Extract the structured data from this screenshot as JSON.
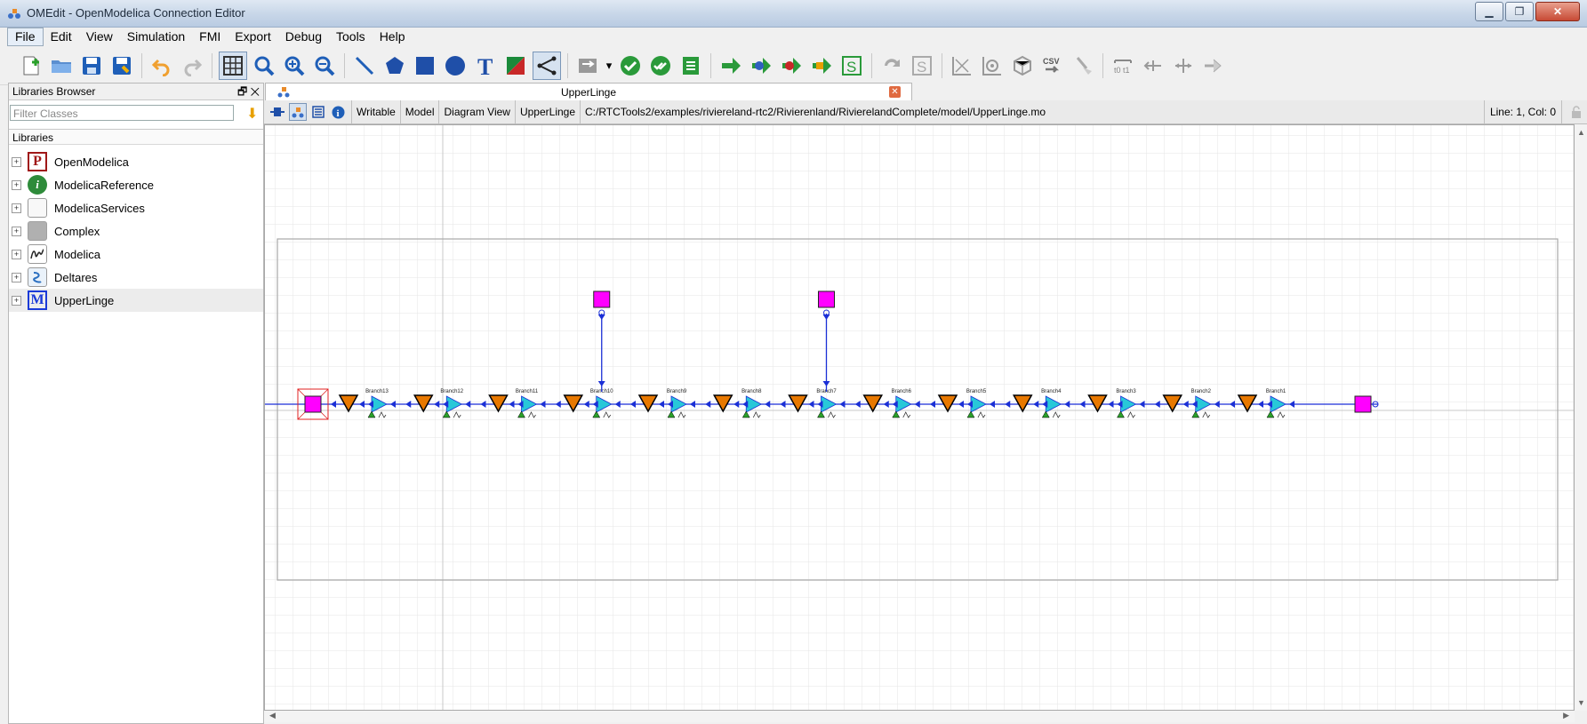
{
  "window": {
    "title": "OMEdit - OpenModelica Connection Editor"
  },
  "menu": [
    "File",
    "Edit",
    "View",
    "Simulation",
    "FMI",
    "Export",
    "Debug",
    "Tools",
    "Help"
  ],
  "libraries_browser": {
    "title": "Libraries Browser",
    "filter_placeholder": "Filter Classes",
    "section_label": "Libraries",
    "items": [
      {
        "label": "OpenModelica",
        "icon": "openmodelica-p-icon"
      },
      {
        "label": "ModelicaReference",
        "icon": "info-icon"
      },
      {
        "label": "ModelicaServices",
        "icon": "blank-package-icon"
      },
      {
        "label": "Complex",
        "icon": "grey-package-icon"
      },
      {
        "label": "Modelica",
        "icon": "modelica-icon"
      },
      {
        "label": "Deltares",
        "icon": "deltares-icon"
      },
      {
        "label": "UpperLinge",
        "icon": "model-m-icon"
      }
    ]
  },
  "document": {
    "tab_title": "UpperLinge",
    "info": {
      "access": "Writable",
      "restriction": "Model",
      "view": "Diagram View",
      "model_name": "UpperLinge",
      "file_path": "C:/RTCTools2/examples/riviereland-rtc2/Rivierenland/RivierelandComplete/model/UpperLinge.mo",
      "cursor": "Line: 1, Col: 0"
    }
  },
  "diagram": {
    "branch_labels": [
      "Branch13",
      "Branch12",
      "Branch11",
      "Branch10",
      "Branch9",
      "Branch8",
      "Branch7",
      "Branch6",
      "Branch5",
      "Branch4",
      "Branch3",
      "Branch2",
      "Branch1"
    ],
    "colors": {
      "line": "#1a2fd6",
      "inflow": "#ff00ff",
      "weir": "#e87800",
      "branch": "#28c8d8",
      "grid": "#e4e4e4"
    }
  }
}
